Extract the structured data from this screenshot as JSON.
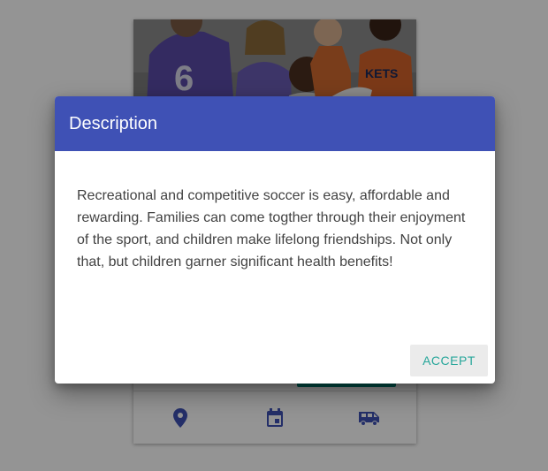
{
  "dialog": {
    "title": "Description",
    "body": "Recreational and competitive soccer is easy, affordable and rewarding. Families can come togther through their enjoyment of the sport, and children make lifelong friendships. Not only that, but children garner significant health benefits!",
    "accept_label": "ACCEPT"
  },
  "card": {
    "footer_icons": [
      "map-marker-icon",
      "calendar-icon",
      "van-icon"
    ]
  },
  "colors": {
    "dialog_header": "#3f51b5",
    "accept_text": "#26a69a",
    "footer_icon": "#3f51b5",
    "action_button": "#00897b"
  }
}
